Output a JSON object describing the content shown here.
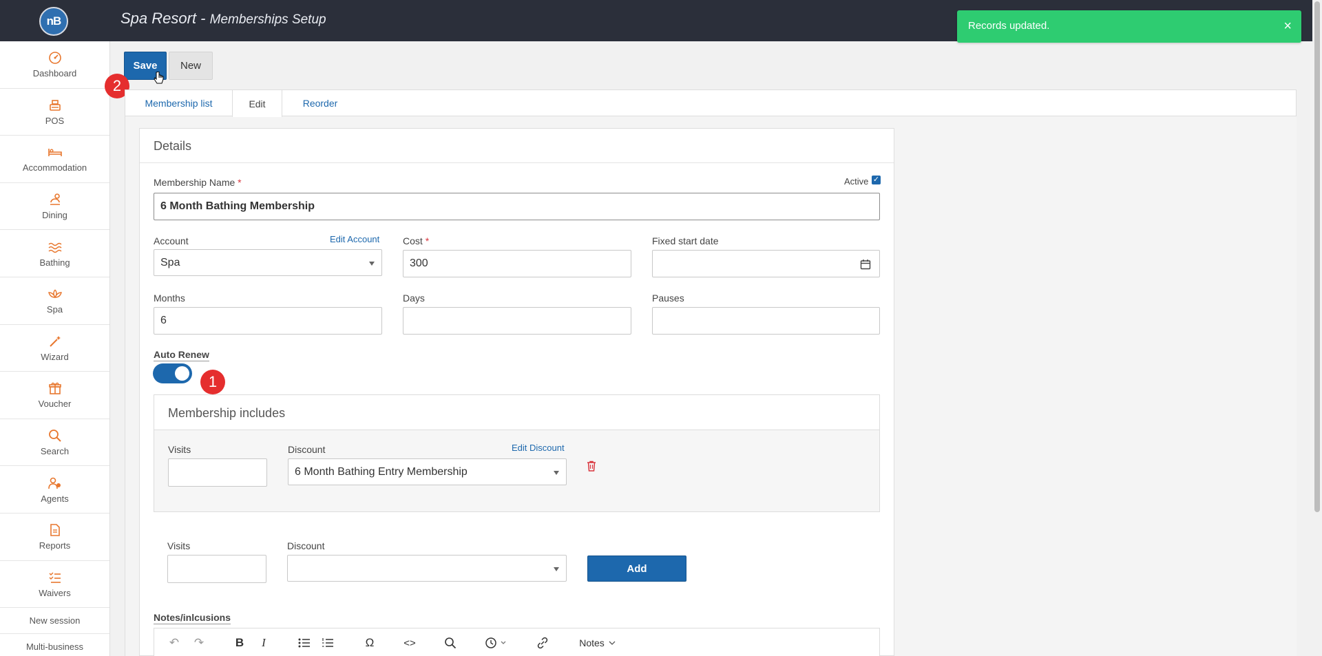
{
  "header": {
    "logo_text": "nB",
    "title": "Spa Resort",
    "separator": " - ",
    "subtitle": "Memberships Setup"
  },
  "toast": {
    "message": "Records updated.",
    "close": "×",
    "color": "#2ecc71"
  },
  "sidebar": {
    "items": [
      {
        "label": "Dashboard",
        "icon": "dashboard-icon"
      },
      {
        "label": "POS",
        "icon": "pos-register-icon"
      },
      {
        "label": "Accommodation",
        "icon": "bed-icon"
      },
      {
        "label": "Dining",
        "icon": "dining-icon"
      },
      {
        "label": "Bathing",
        "icon": "waves-icon"
      },
      {
        "label": "Spa",
        "icon": "lotus-icon"
      },
      {
        "label": "Wizard",
        "icon": "magic-wand-icon"
      },
      {
        "label": "Voucher",
        "icon": "gift-icon"
      },
      {
        "label": "Search",
        "icon": "search-icon"
      },
      {
        "label": "Agents",
        "icon": "agents-icon"
      },
      {
        "label": "Reports",
        "icon": "report-icon"
      },
      {
        "label": "Waivers",
        "icon": "checklist-icon"
      }
    ],
    "links": [
      "New session",
      "Multi-business"
    ]
  },
  "toolbar": {
    "save_label": "Save",
    "new_label": "New"
  },
  "annotations": {
    "step1": "1",
    "step2": "2"
  },
  "tabs": [
    "Membership list",
    "Edit",
    "Reorder"
  ],
  "details": {
    "heading": "Details",
    "name_label": "Membership Name",
    "required_mark": "*",
    "name_value": "6 Month Bathing Membership",
    "active_label": "Active",
    "active_checked": true,
    "account_label": "Account",
    "edit_account": "Edit Account",
    "account_value": "Spa",
    "cost_label": "Cost",
    "cost_value": "300",
    "fixed_start_label": "Fixed start date",
    "fixed_start_value": "",
    "months_label": "Months",
    "months_value": "6",
    "days_label": "Days",
    "days_value": "",
    "pauses_label": "Pauses",
    "pauses_value": "",
    "auto_renew_label": "Auto Renew",
    "auto_renew_on": true
  },
  "includes": {
    "heading": "Membership includes",
    "visits_label": "Visits",
    "discount_label": "Discount",
    "edit_discount": "Edit Discount",
    "visits_value": "",
    "discount_value": "6 Month Bathing Entry Membership"
  },
  "new_row": {
    "visits_label": "Visits",
    "discount_label": "Discount",
    "visits_value": "",
    "discount_value": "",
    "add_label": "Add"
  },
  "notes": {
    "label": "Notes/inlcusions",
    "menu_label": "Notes"
  },
  "colors": {
    "primary": "#1d68ad",
    "accent_icon": "#e8772e",
    "header_bg": "#2b2f3a",
    "badge": "#e52e2e"
  }
}
